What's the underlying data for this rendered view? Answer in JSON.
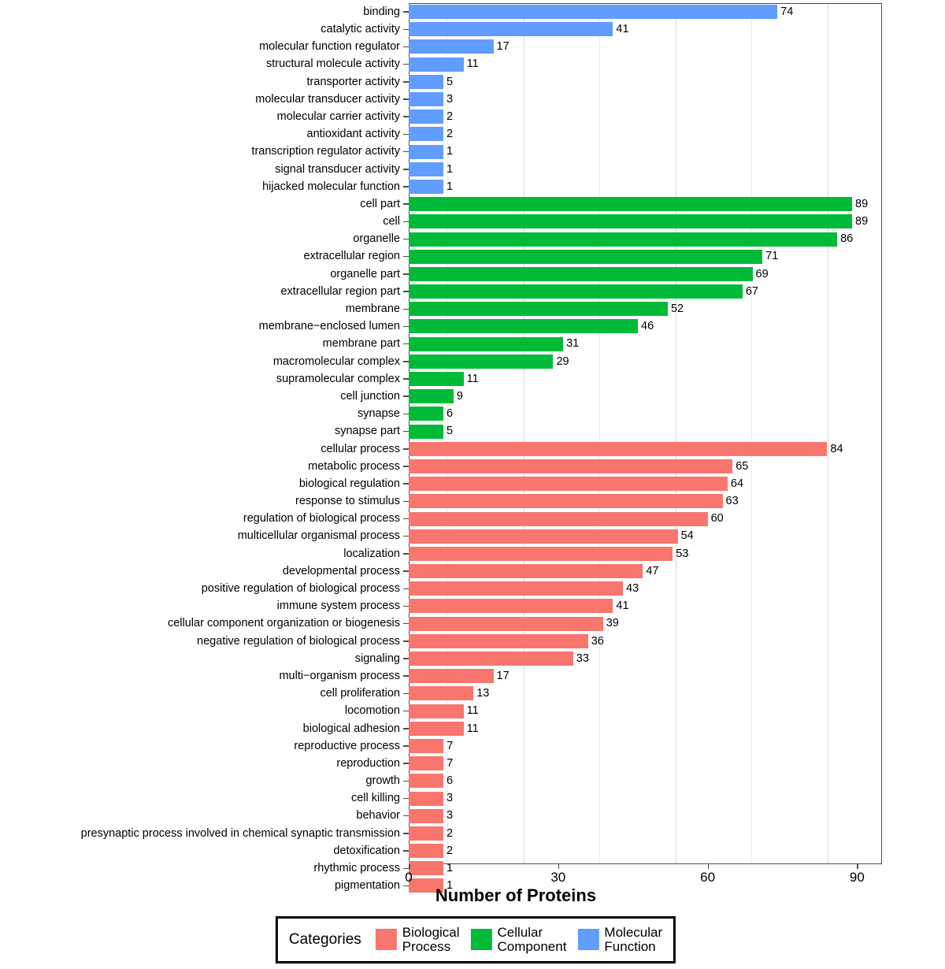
{
  "chart_data": {
    "type": "bar",
    "orientation": "horizontal",
    "title": "",
    "xlabel": "Number of Proteins",
    "ylabel": "",
    "xlim": [
      0,
      95
    ],
    "xticks": [
      0,
      30,
      60,
      90
    ],
    "xticklabels": [
      "0",
      "30",
      "60",
      "90"
    ],
    "grid": true,
    "legend_position": "bottom",
    "legend_title": "Categories",
    "colors": {
      "Biological Process": "#F8766D",
      "Cellular Component": "#00BA38",
      "Molecular Function": "#619CFF"
    },
    "series": [
      {
        "name": "Molecular Function",
        "color": "#619CFF"
      },
      {
        "name": "Cellular Component",
        "color": "#00BA38"
      },
      {
        "name": "Biological Process",
        "color": "#F8766D"
      }
    ],
    "categories": [
      "binding",
      "catalytic activity",
      "molecular function regulator",
      "structural molecule activity",
      "transporter activity",
      "molecular transducer activity",
      "molecular carrier activity",
      "antioxidant activity",
      "transcription regulator activity",
      "signal transducer activity",
      "hijacked molecular function",
      "cell part",
      "cell",
      "organelle",
      "extracellular region",
      "organelle part",
      "extracellular region part",
      "membrane",
      "membrane−enclosed lumen",
      "membrane part",
      "macromolecular complex",
      "supramolecular complex",
      "cell junction",
      "synapse",
      "synapse part",
      "cellular process",
      "metabolic process",
      "biological regulation",
      "response to stimulus",
      "regulation of biological process",
      "multicellular organismal process",
      "localization",
      "developmental process",
      "positive regulation of biological process",
      "immune system process",
      "cellular component organization or biogenesis",
      "negative regulation of biological process",
      "signaling",
      "multi−organism process",
      "cell proliferation",
      "locomotion",
      "biological adhesion",
      "reproductive process",
      "reproduction",
      "growth",
      "cell killing",
      "behavior",
      "presynaptic process involved in chemical synaptic transmission",
      "detoxification",
      "rhythmic process",
      "pigmentation"
    ],
    "values": [
      74,
      41,
      17,
      11,
      5,
      3,
      2,
      2,
      1,
      1,
      1,
      89,
      89,
      86,
      71,
      69,
      67,
      52,
      46,
      31,
      29,
      11,
      9,
      6,
      5,
      84,
      65,
      64,
      63,
      60,
      54,
      53,
      47,
      43,
      41,
      39,
      36,
      33,
      17,
      13,
      11,
      11,
      7,
      7,
      6,
      3,
      3,
      2,
      2,
      1,
      1
    ],
    "bars": [
      {
        "label": "binding",
        "value": 74,
        "group": "Molecular Function"
      },
      {
        "label": "catalytic activity",
        "value": 41,
        "group": "Molecular Function"
      },
      {
        "label": "molecular function regulator",
        "value": 17,
        "group": "Molecular Function"
      },
      {
        "label": "structural molecule activity",
        "value": 11,
        "group": "Molecular Function"
      },
      {
        "label": "transporter activity",
        "value": 5,
        "group": "Molecular Function"
      },
      {
        "label": "molecular transducer activity",
        "value": 3,
        "group": "Molecular Function"
      },
      {
        "label": "molecular carrier activity",
        "value": 2,
        "group": "Molecular Function"
      },
      {
        "label": "antioxidant activity",
        "value": 2,
        "group": "Molecular Function"
      },
      {
        "label": "transcription regulator activity",
        "value": 1,
        "group": "Molecular Function"
      },
      {
        "label": "signal transducer activity",
        "value": 1,
        "group": "Molecular Function"
      },
      {
        "label": "hijacked molecular function",
        "value": 1,
        "group": "Molecular Function"
      },
      {
        "label": "cell part",
        "value": 89,
        "group": "Cellular Component"
      },
      {
        "label": "cell",
        "value": 89,
        "group": "Cellular Component"
      },
      {
        "label": "organelle",
        "value": 86,
        "group": "Cellular Component"
      },
      {
        "label": "extracellular region",
        "value": 71,
        "group": "Cellular Component"
      },
      {
        "label": "organelle part",
        "value": 69,
        "group": "Cellular Component"
      },
      {
        "label": "extracellular region part",
        "value": 67,
        "group": "Cellular Component"
      },
      {
        "label": "membrane",
        "value": 52,
        "group": "Cellular Component"
      },
      {
        "label": "membrane−enclosed lumen",
        "value": 46,
        "group": "Cellular Component"
      },
      {
        "label": "membrane part",
        "value": 31,
        "group": "Cellular Component"
      },
      {
        "label": "macromolecular complex",
        "value": 29,
        "group": "Cellular Component"
      },
      {
        "label": "supramolecular complex",
        "value": 11,
        "group": "Cellular Component"
      },
      {
        "label": "cell junction",
        "value": 9,
        "group": "Cellular Component"
      },
      {
        "label": "synapse",
        "value": 6,
        "group": "Cellular Component"
      },
      {
        "label": "synapse part",
        "value": 5,
        "group": "Cellular Component"
      },
      {
        "label": "cellular process",
        "value": 84,
        "group": "Biological Process"
      },
      {
        "label": "metabolic process",
        "value": 65,
        "group": "Biological Process"
      },
      {
        "label": "biological regulation",
        "value": 64,
        "group": "Biological Process"
      },
      {
        "label": "response to stimulus",
        "value": 63,
        "group": "Biological Process"
      },
      {
        "label": "regulation of biological process",
        "value": 60,
        "group": "Biological Process"
      },
      {
        "label": "multicellular organismal process",
        "value": 54,
        "group": "Biological Process"
      },
      {
        "label": "localization",
        "value": 53,
        "group": "Biological Process"
      },
      {
        "label": "developmental process",
        "value": 47,
        "group": "Biological Process"
      },
      {
        "label": "positive regulation of biological process",
        "value": 43,
        "group": "Biological Process"
      },
      {
        "label": "immune system process",
        "value": 41,
        "group": "Biological Process"
      },
      {
        "label": "cellular component organization or biogenesis",
        "value": 39,
        "group": "Biological Process"
      },
      {
        "label": "negative regulation of biological process",
        "value": 36,
        "group": "Biological Process"
      },
      {
        "label": "signaling",
        "value": 33,
        "group": "Biological Process"
      },
      {
        "label": "multi−organism process",
        "value": 17,
        "group": "Biological Process"
      },
      {
        "label": "cell proliferation",
        "value": 13,
        "group": "Biological Process"
      },
      {
        "label": "locomotion",
        "value": 11,
        "group": "Biological Process"
      },
      {
        "label": "biological adhesion",
        "value": 11,
        "group": "Biological Process"
      },
      {
        "label": "reproductive process",
        "value": 7,
        "group": "Biological Process"
      },
      {
        "label": "reproduction",
        "value": 7,
        "group": "Biological Process"
      },
      {
        "label": "growth",
        "value": 6,
        "group": "Biological Process"
      },
      {
        "label": "cell killing",
        "value": 3,
        "group": "Biological Process"
      },
      {
        "label": "behavior",
        "value": 3,
        "group": "Biological Process"
      },
      {
        "label": "presynaptic process involved in chemical synaptic transmission",
        "value": 2,
        "group": "Biological Process"
      },
      {
        "label": "detoxification",
        "value": 2,
        "group": "Biological Process"
      },
      {
        "label": "rhythmic process",
        "value": 1,
        "group": "Biological Process"
      },
      {
        "label": "pigmentation",
        "value": 1,
        "group": "Biological Process"
      }
    ]
  },
  "axis": {
    "x_title": "Number of Proteins",
    "ticks": [
      "0",
      "30",
      "60",
      "90"
    ]
  },
  "legend": {
    "title": "Categories",
    "items": [
      {
        "label": "Biological\nProcess",
        "color": "#F8766D"
      },
      {
        "label": "Cellular\nComponent",
        "color": "#00BA38"
      },
      {
        "label": "Molecular\nFunction",
        "color": "#619CFF"
      }
    ]
  }
}
